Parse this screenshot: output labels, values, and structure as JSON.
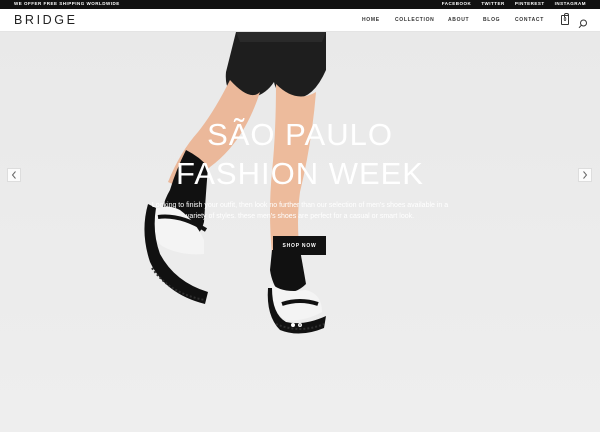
{
  "topbar": {
    "promo": "WE OFFER FREE SHIPPING WORLDWIDE",
    "social": [
      "FACEBOOK",
      "TWITTER",
      "PINTEREST",
      "INSTAGRAM"
    ]
  },
  "header": {
    "logo": "BRIDGE",
    "nav": [
      "HOME",
      "COLLECTION",
      "ABOUT",
      "BLOG",
      "CONTACT"
    ],
    "cart_count": "0"
  },
  "hero": {
    "title_line1": "SÃO PAULO",
    "title_line2": "FASHION WEEK",
    "description": "Looking to finish your outfit, then look no further than our selection of men's shoes available in a variety of styles. these men's shoes are perfect for a casual or smart look.",
    "button_label": "SHOP NOW",
    "slides_count": 2,
    "active_slide": 1
  },
  "icons": {
    "cart": "shopping-bag-icon",
    "search": "search-icon",
    "prev": "chevron-left-icon",
    "next": "chevron-right-icon"
  }
}
